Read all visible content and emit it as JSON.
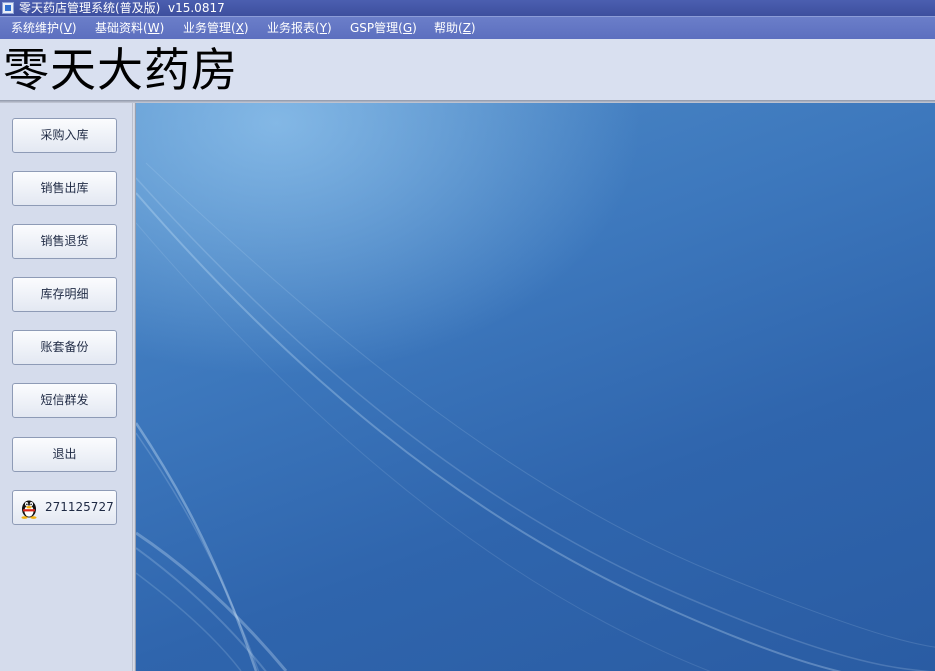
{
  "window": {
    "title": "零天药店管理系统(普及版)",
    "version": "v15.0817",
    "app_icon": "app-icon"
  },
  "menu": [
    {
      "label": "系统维护(",
      "accel": "V",
      "suffix": ")"
    },
    {
      "label": "基础资料(",
      "accel": "W",
      "suffix": ")"
    },
    {
      "label": "业务管理(",
      "accel": "X",
      "suffix": ")"
    },
    {
      "label": "业务报表(",
      "accel": "Y",
      "suffix": ")"
    },
    {
      "label": "GSP管理(",
      "accel": "G",
      "suffix": ")"
    },
    {
      "label": "帮助(",
      "accel": "Z",
      "suffix": ")"
    }
  ],
  "banner": {
    "title": "零天大药房"
  },
  "sidebar": {
    "buttons": [
      {
        "label": "采购入库"
      },
      {
        "label": "销售出库"
      },
      {
        "label": "销售退货"
      },
      {
        "label": "库存明细"
      },
      {
        "label": "账套备份"
      },
      {
        "label": "短信群发"
      },
      {
        "label": "退出"
      }
    ],
    "qq": {
      "icon": "qq-penguin-icon",
      "number": "271125727"
    }
  },
  "colors": {
    "titlebar": "#3d4f9e",
    "menubar": "#5c6fbf",
    "panel": "#d5dcec",
    "desktop": "#2f65ad"
  }
}
